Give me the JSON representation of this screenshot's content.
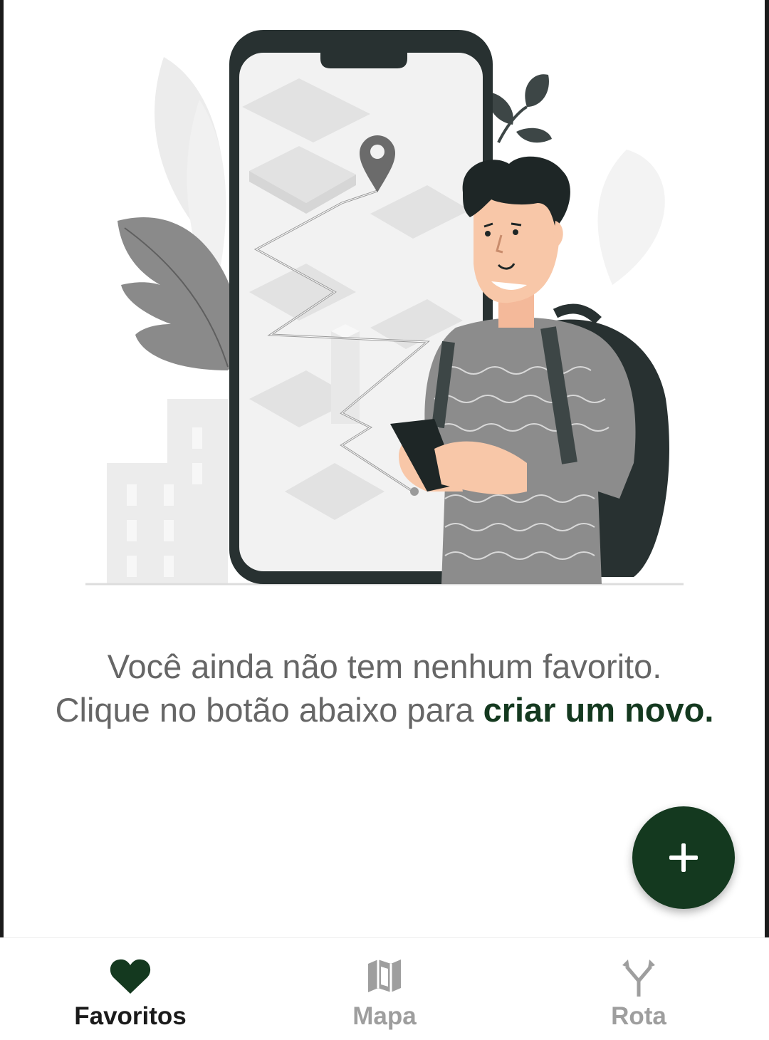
{
  "empty_state": {
    "message_line1": "Você ainda não tem nenhum favorito.",
    "message_line2_start": "Clique no botão abaixo para ",
    "cta_text": "criar um novo."
  },
  "fab": {
    "icon": "plus-icon",
    "color": "#14391f"
  },
  "bottom_nav": {
    "items": [
      {
        "label": "Favoritos",
        "icon": "heart-icon",
        "active": true
      },
      {
        "label": "Mapa",
        "icon": "map-icon",
        "active": false
      },
      {
        "label": "Rota",
        "icon": "route-icon",
        "active": false
      }
    ],
    "active_color": "#14391f",
    "inactive_color": "#9e9e9e"
  }
}
